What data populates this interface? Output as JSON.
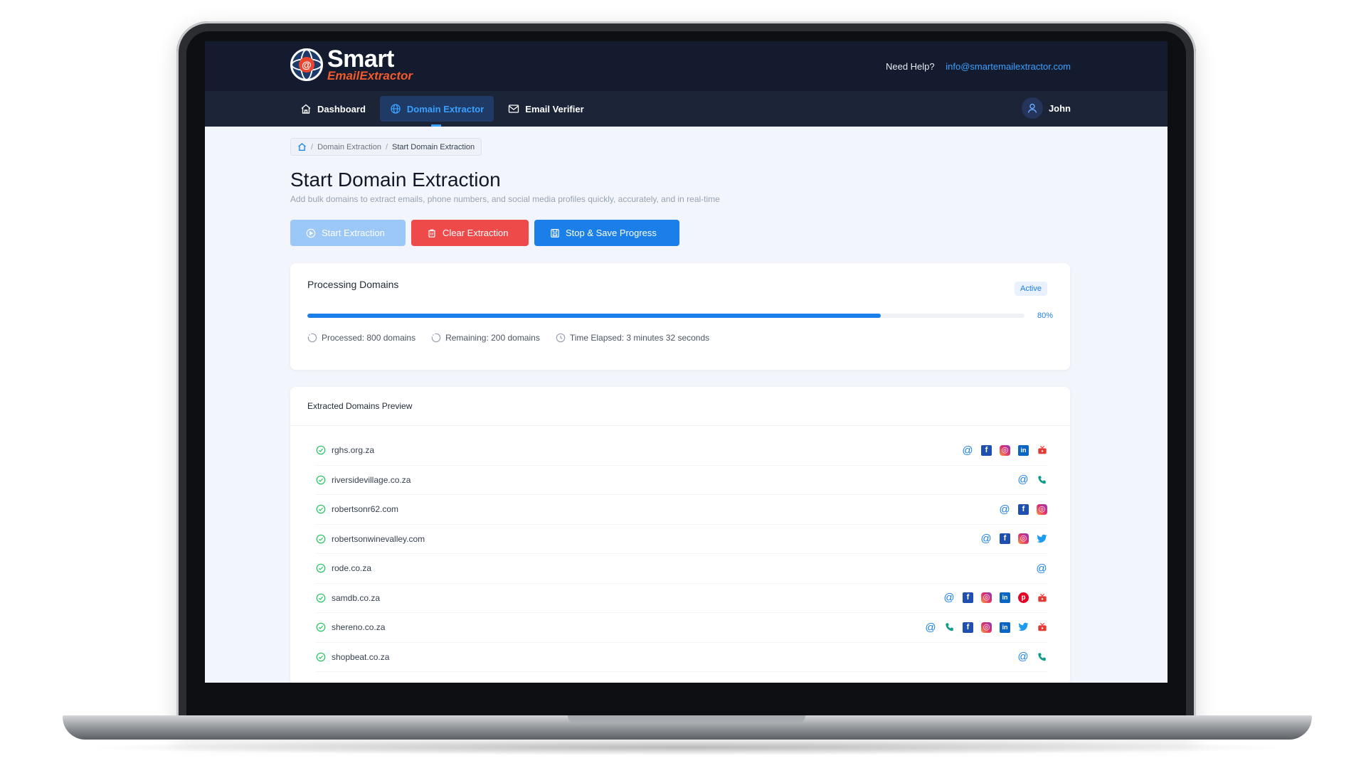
{
  "app": {
    "logo_main": "Smart",
    "logo_sub": "EmailExtractor",
    "help_label": "Need Help?",
    "help_email": "info@smartemailextractor.com"
  },
  "nav": {
    "items": [
      {
        "label": "Dashboard",
        "icon": "home-icon",
        "active": false
      },
      {
        "label": "Domain Extractor",
        "icon": "globe-icon",
        "active": true
      },
      {
        "label": "Email Verifier",
        "icon": "mail-icon",
        "active": false
      }
    ],
    "user_name": "John"
  },
  "breadcrumb": {
    "home_icon": "home-icon",
    "items": [
      "Domain Extraction",
      "Start Domain Extraction"
    ],
    "separator": "/"
  },
  "page": {
    "title": "Start Domain Extraction",
    "subtitle": "Add bulk domains to extract emails, phone numbers, and social media profiles quickly, accurately, and in real-time"
  },
  "actions": {
    "start_label": "Start Extraction",
    "clear_label": "Clear Extraction",
    "stop_label": "Stop & Save Progress"
  },
  "progress": {
    "title": "Processing Domains",
    "status": "Active",
    "percent": 80,
    "percent_label": "80%",
    "processed": "Processed: 800 domains",
    "remaining": "Remaining: 200 domains",
    "elapsed": "Time Elapsed: 3 minutes 32 seconds"
  },
  "preview": {
    "title": "Extracted Domains Preview",
    "rows": [
      {
        "domain": "rghs.org.za",
        "icons": [
          "email",
          "facebook",
          "instagram",
          "linkedin",
          "youtube"
        ]
      },
      {
        "domain": "riversidevillage.co.za",
        "icons": [
          "email",
          "phone"
        ]
      },
      {
        "domain": "robertsonr62.com",
        "icons": [
          "email",
          "facebook",
          "instagram"
        ]
      },
      {
        "domain": "robertsonwinevalley.com",
        "icons": [
          "email",
          "facebook",
          "instagram",
          "twitter"
        ]
      },
      {
        "domain": "rode.co.za",
        "icons": [
          "email"
        ]
      },
      {
        "domain": "samdb.co.za",
        "icons": [
          "email",
          "facebook",
          "instagram",
          "linkedin",
          "pinterest",
          "youtube"
        ]
      },
      {
        "domain": "shereno.co.za",
        "icons": [
          "email",
          "phone",
          "facebook",
          "instagram",
          "linkedin",
          "twitter",
          "youtube"
        ]
      },
      {
        "domain": "shopbeat.co.za",
        "icons": [
          "email",
          "phone"
        ]
      }
    ]
  },
  "colors": {
    "header_bg": "#151b2e",
    "nav_bg": "#1c2438",
    "accent": "#1a7fe8",
    "danger": "#ef4a4a",
    "start_disabled": "#9cc8f7",
    "success": "#22c55e"
  }
}
